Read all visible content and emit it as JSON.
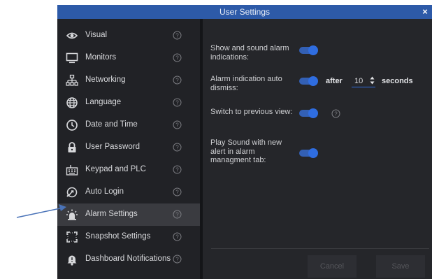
{
  "window": {
    "title": "User Settings",
    "close_glyph": "×"
  },
  "sidebar": {
    "items": [
      {
        "label": "Visual",
        "icon": "eye-icon"
      },
      {
        "label": "Monitors",
        "icon": "monitor-icon"
      },
      {
        "label": "Networking",
        "icon": "network-icon"
      },
      {
        "label": "Language",
        "icon": "globe-icon"
      },
      {
        "label": "Date and Time",
        "icon": "clock-icon"
      },
      {
        "label": "User Password",
        "icon": "lock-icon"
      },
      {
        "label": "Keypad and PLC",
        "icon": "keypad-icon"
      },
      {
        "label": "Auto Login",
        "icon": "auto-login-icon"
      },
      {
        "label": "Alarm Settings",
        "icon": "alarm-light-icon",
        "active": true
      },
      {
        "label": "Snapshot Settings",
        "icon": "snapshot-icon"
      },
      {
        "label": "Dashboard Notifications",
        "icon": "bell-icon"
      }
    ]
  },
  "alarm_settings": {
    "show_sound": {
      "label": "Show and sound alarm indications:",
      "enabled": true
    },
    "auto_dismiss": {
      "label": "Alarm indication auto dismiss:",
      "enabled": true,
      "after_text": "after",
      "value": "10",
      "unit": "seconds"
    },
    "switch_previous": {
      "label": "Switch to previous view:",
      "enabled": true
    },
    "play_sound": {
      "label": "Play Sound with new alert in alarm managment tab:",
      "enabled": true
    }
  },
  "buttons": {
    "cancel": "Cancel",
    "save": "Save"
  },
  "colors": {
    "title_bar": "#2d5aa8",
    "panel_bg": "#25262a",
    "sidebar_bg": "#212226",
    "active_item": "#3a3b40",
    "toggle_on": "#2f6de0",
    "annotation_arrow": "#4a73b8"
  }
}
